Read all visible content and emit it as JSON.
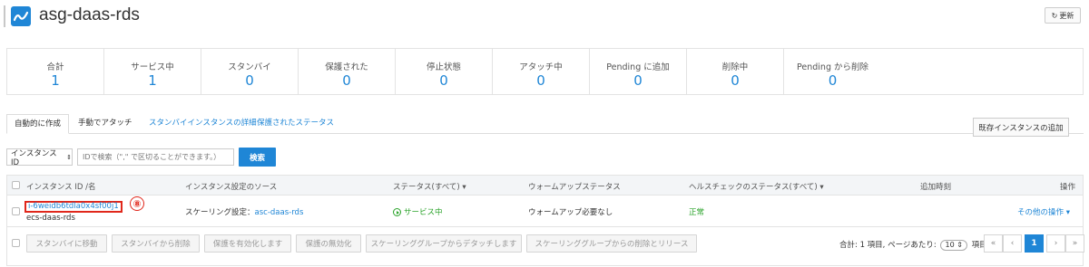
{
  "header": {
    "title": "asg-daas-rds",
    "refresh_label": "更新"
  },
  "stats": [
    {
      "label": "合計",
      "value": "1"
    },
    {
      "label": "サービス中",
      "value": "1"
    },
    {
      "label": "スタンバイ",
      "value": "0"
    },
    {
      "label": "保護された",
      "value": "0"
    },
    {
      "label": "停止状態",
      "value": "0"
    },
    {
      "label": "アタッチ中",
      "value": "0"
    },
    {
      "label": "Pending に追加",
      "value": "0"
    },
    {
      "label": "削除中",
      "value": "0"
    },
    {
      "label": "Pending から削除",
      "value": "0"
    }
  ],
  "tabs": {
    "auto_created": "自動的に作成",
    "manual_attach": "手動でアタッチ",
    "standby_details": "スタンバイインスタンスの詳細",
    "protected_status": "保護されたステータス"
  },
  "add_existing_label": "既存インスタンスの追加",
  "search": {
    "select_value": "インスタンス ID",
    "placeholder": "IDで検索（\",\" で区切ることができます。）",
    "button_label": "検索"
  },
  "table": {
    "headers": {
      "instance": "インスタンス ID /名",
      "source": "インスタンス設定のソース",
      "status": "ステータス(すべて)",
      "warmup": "ウォームアップステータス",
      "health": "ヘルスチェックのステータス(すべて)",
      "added": "追加時刻",
      "actions": "操作"
    },
    "row": {
      "instance_id": "i-6weidb6tdla0x4sf00j1",
      "instance_name": "ecs-daas-rds",
      "annotation": "⑧",
      "source_prefix": "スケーリング設定：",
      "source_link": "asc-daas-rds",
      "status": "サービス中",
      "warmup": "ウォームアップ必要なし",
      "health": "正常",
      "added": "",
      "more_actions": "その他の操作"
    }
  },
  "footer": {
    "buttons": [
      "スタンバイに移動",
      "スタンバイから削除",
      "保護を有効化します",
      "保護の無効化",
      "スケーリンググループからデタッチします",
      "スケーリンググループからの削除とリリース"
    ],
    "summary_prefix": "合計: 1 項目, ページあたり:",
    "page_size": "10",
    "summary_suffix": "項目",
    "pages": {
      "first": "«",
      "prev": "‹",
      "current": "1",
      "next": "›",
      "last": "»"
    }
  },
  "colors": {
    "accent": "#1f86d6",
    "annotation": "#e0271b",
    "status_ok": "#2aa32a"
  }
}
